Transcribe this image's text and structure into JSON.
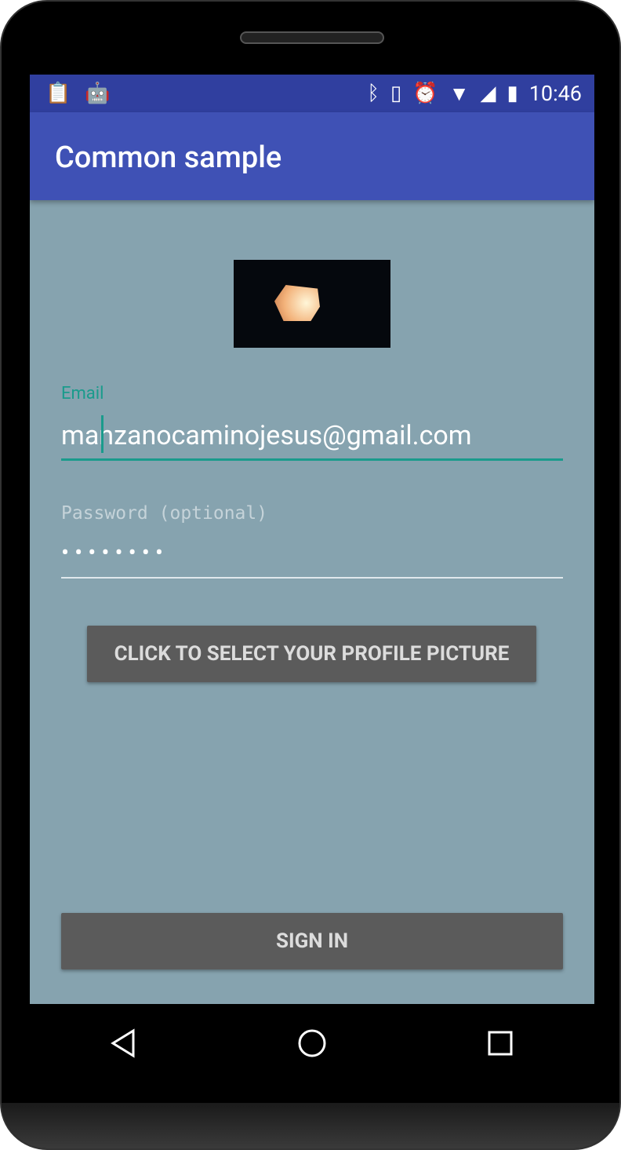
{
  "status_bar": {
    "time": "10:46",
    "left_icons": [
      "clipboard-check-icon",
      "android-icon"
    ],
    "right_icons": [
      "bluetooth-icon",
      "vibrate-icon",
      "alarm-icon",
      "wifi-icon",
      "signal-icon",
      "battery-charging-icon"
    ]
  },
  "app_bar": {
    "title": "Common sample"
  },
  "form": {
    "email_label": "Email",
    "email_value": "manzanocaminojesus@gmail.com",
    "password_label": "Password (optional)",
    "password_value": "••••••••",
    "select_picture_label": "CLICK TO SELECT YOUR PROFILE PICTURE",
    "sign_in_label": "SIGN IN"
  },
  "colors": {
    "status_bar": "#303f9f",
    "app_bar": "#3f51b5",
    "background": "#86a3af",
    "accent": "#1a9b8c",
    "button": "#5b5b5b"
  }
}
